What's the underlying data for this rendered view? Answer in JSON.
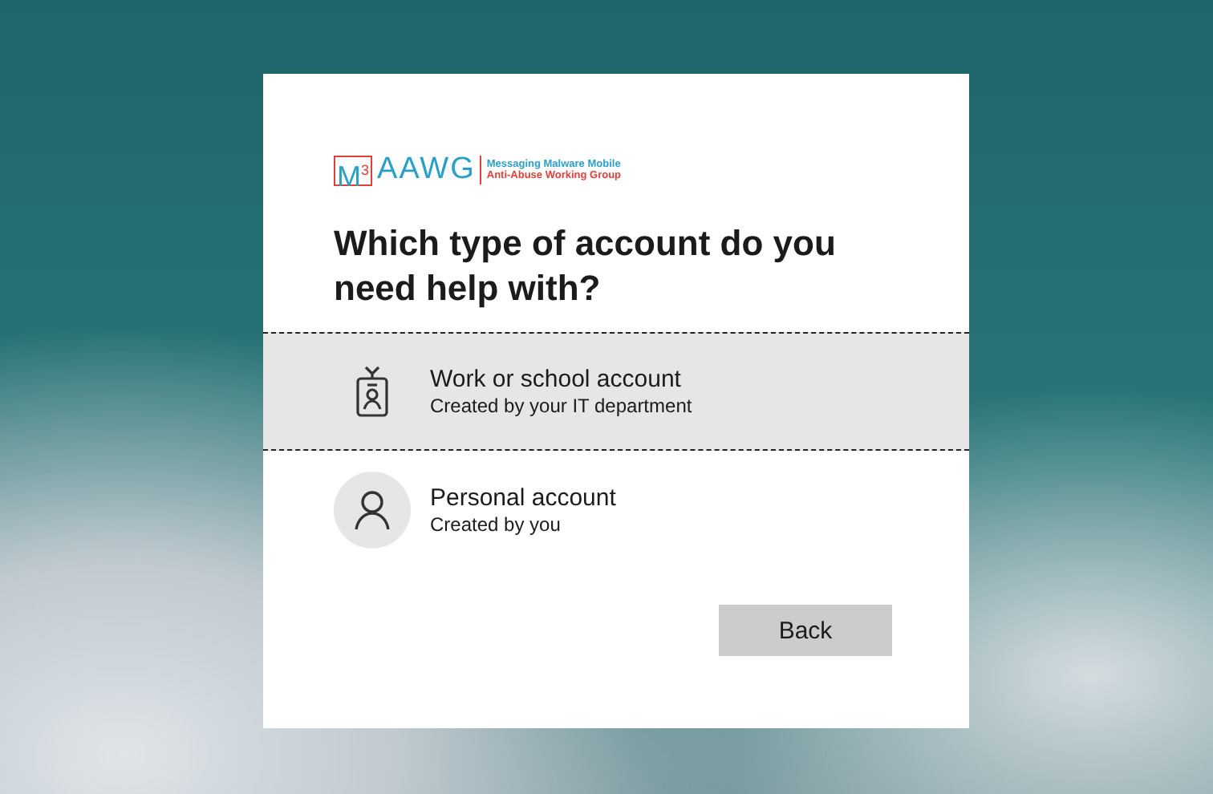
{
  "logo": {
    "mark": "M",
    "mark_sup": "3",
    "wordmark": "AAWG",
    "line1": "Messaging Malware Mobile",
    "line2": "Anti-Abuse Working Group"
  },
  "heading": "Which type of account do you need help with?",
  "options": [
    {
      "kind": "work",
      "title": "Work or school account",
      "subtitle": "Created by your IT department",
      "selected": true
    },
    {
      "kind": "personal",
      "title": "Personal account",
      "subtitle": "Created by you",
      "selected": false
    }
  ],
  "buttons": [
    {
      "label": "Back"
    }
  ]
}
